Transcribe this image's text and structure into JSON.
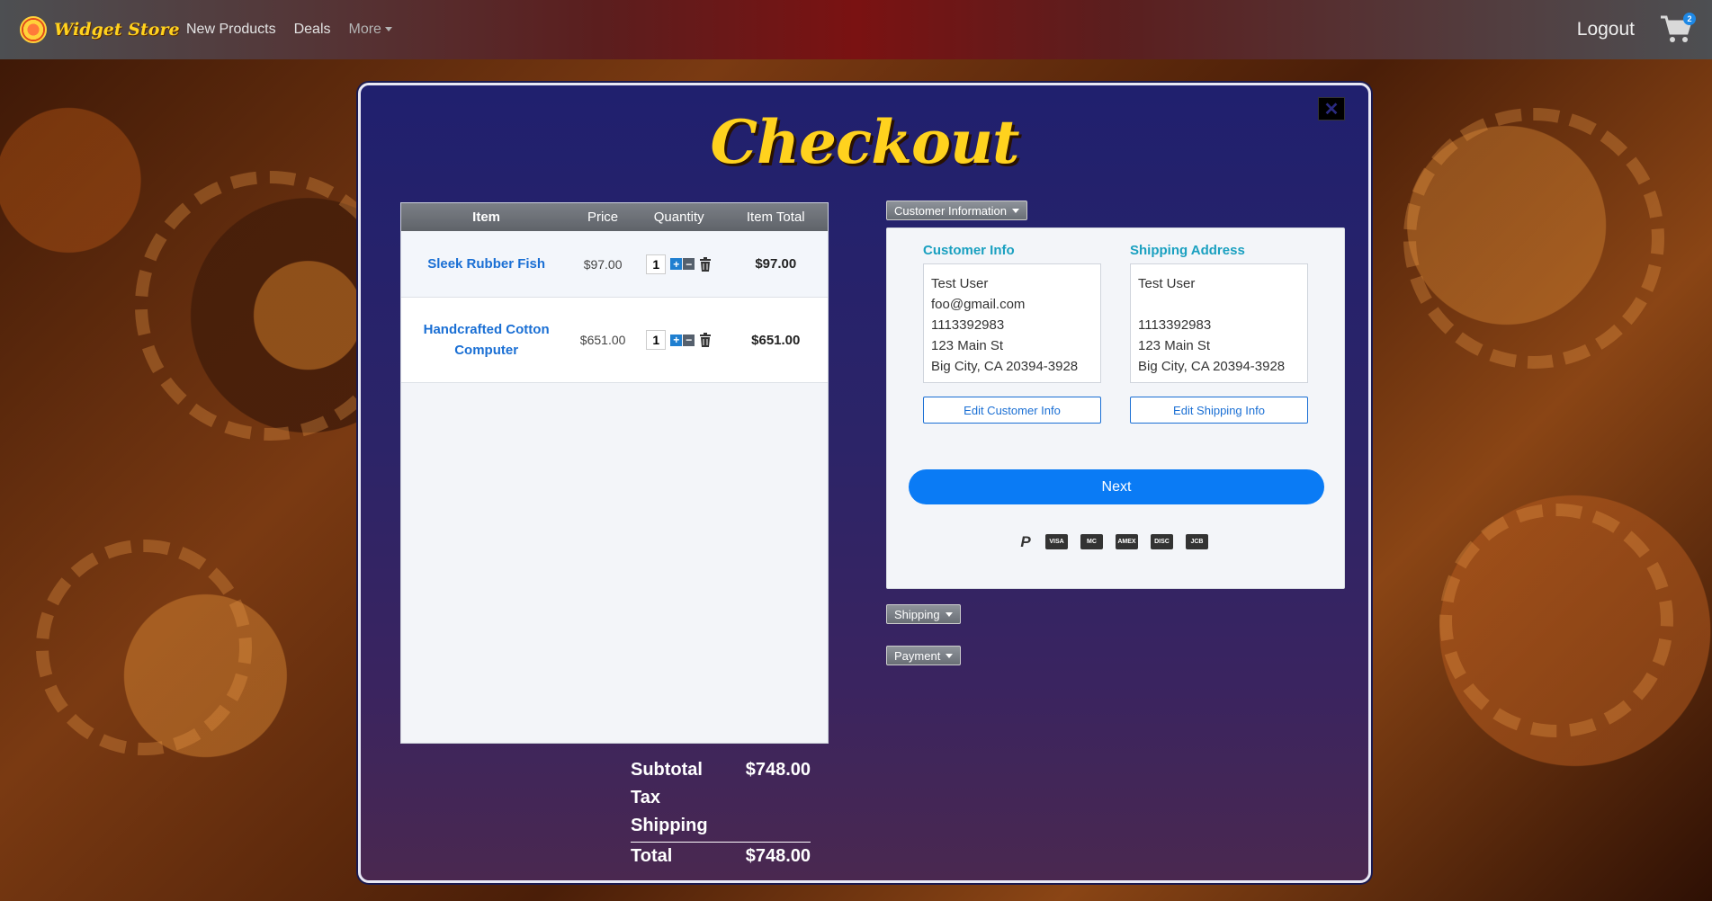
{
  "navbar": {
    "brand": "Widget Store",
    "links": [
      "New Products",
      "Deals",
      "More"
    ],
    "logout": "Logout",
    "cart_count": "2"
  },
  "modal": {
    "title": "Checkout",
    "close_icon": "close-icon"
  },
  "cart": {
    "headers": {
      "item": "Item",
      "price": "Price",
      "quantity": "Quantity",
      "total": "Item Total"
    },
    "rows": [
      {
        "name": "Sleek Rubber Fish",
        "price": "$97.00",
        "qty": "1",
        "total": "$97.00"
      },
      {
        "name": "Handcrafted Cotton Computer",
        "price": "$651.00",
        "qty": "1",
        "total": "$651.00"
      }
    ]
  },
  "totals": {
    "subtotal_label": "Subtotal",
    "subtotal": "$748.00",
    "tax_label": "Tax",
    "tax": "",
    "shipping_label": "Shipping",
    "shipping": "",
    "total_label": "Total",
    "total": "$748.00"
  },
  "accordion": {
    "customer": "Customer Information",
    "shipping": "Shipping",
    "payment": "Payment"
  },
  "customer_info": {
    "title": "Customer Info",
    "lines": [
      "Test User",
      "foo@gmail.com",
      "1113392983",
      "123 Main St",
      "Big City, CA 20394-3928"
    ],
    "edit": "Edit Customer Info"
  },
  "shipping_address": {
    "title": "Shipping Address",
    "lines": [
      "Test User",
      "",
      "1113392983",
      "123 Main St",
      "Big City, CA 20394-3928"
    ],
    "edit": "Edit Shipping Info"
  },
  "next_label": "Next",
  "payment_icons": [
    {
      "name": "paypal-icon",
      "text": "P"
    },
    {
      "name": "visa-icon",
      "text": "VISA"
    },
    {
      "name": "mastercard-icon",
      "text": "MC"
    },
    {
      "name": "amex-icon",
      "text": "AMEX"
    },
    {
      "name": "discover-icon",
      "text": "DISC"
    },
    {
      "name": "jcb-icon",
      "text": "JCB"
    }
  ]
}
